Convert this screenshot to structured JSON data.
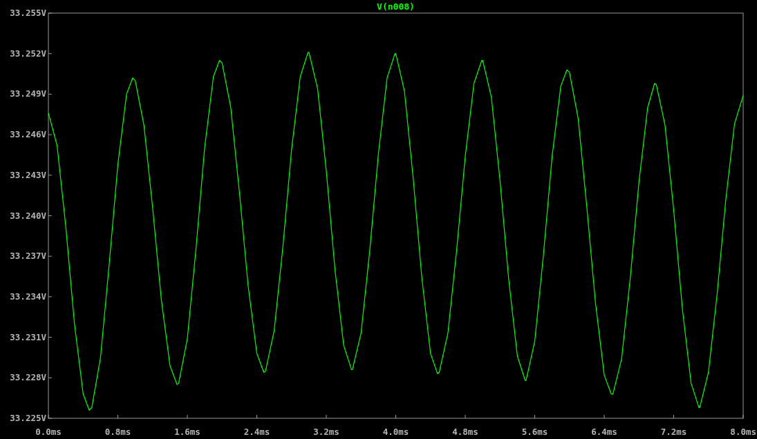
{
  "plot": {
    "chart_data": {
      "type": "line",
      "x": [
        0,
        0.1,
        0.2,
        0.3,
        0.4,
        0.47,
        0.5,
        0.6,
        0.7,
        0.8,
        0.9,
        0.97,
        1.0,
        1.1,
        1.2,
        1.3,
        1.4,
        1.48,
        1.5,
        1.6,
        1.7,
        1.8,
        1.9,
        1.97,
        2.0,
        2.1,
        2.2,
        2.3,
        2.4,
        2.48,
        2.5,
        2.6,
        2.7,
        2.8,
        2.9,
        2.99,
        3.0,
        3.1,
        3.2,
        3.3,
        3.4,
        3.49,
        3.5,
        3.6,
        3.7,
        3.8,
        3.9,
        3.99,
        4.0,
        4.1,
        4.2,
        4.3,
        4.4,
        4.48,
        4.5,
        4.6,
        4.7,
        4.8,
        4.9,
        4.99,
        5.0,
        5.1,
        5.2,
        5.3,
        5.4,
        5.49,
        5.5,
        5.6,
        5.7,
        5.8,
        5.9,
        5.97,
        6.0,
        6.1,
        6.2,
        6.3,
        6.4,
        6.48,
        6.5,
        6.6,
        6.7,
        6.8,
        6.9,
        6.98,
        7.0,
        7.1,
        7.2,
        7.3,
        7.4,
        7.49,
        7.5,
        7.6,
        7.7,
        7.8,
        7.9,
        8.0
      ],
      "series": [
        {
          "name": "V(n008)",
          "color": "#00ff00",
          "values": [
            33.2476,
            33.2452,
            33.2392,
            33.232,
            33.2268,
            33.2256,
            33.2258,
            33.2295,
            33.2364,
            33.2438,
            33.249,
            33.2502,
            33.25,
            33.2467,
            33.2406,
            33.2338,
            33.2289,
            33.2275,
            33.2276,
            33.2309,
            33.2376,
            33.2451,
            33.2503,
            33.2515,
            33.2513,
            33.248,
            33.2417,
            33.2348,
            33.2298,
            33.2284,
            33.2285,
            33.2315,
            33.2377,
            33.2449,
            33.2503,
            33.2521,
            33.2521,
            33.2494,
            33.2433,
            33.236,
            33.2304,
            33.2286,
            33.2286,
            33.2313,
            33.2374,
            33.2446,
            33.2502,
            33.252,
            33.252,
            33.2492,
            33.2428,
            33.2354,
            33.2298,
            33.2283,
            33.2284,
            33.2313,
            33.2374,
            33.2444,
            33.2498,
            33.2515,
            33.2515,
            33.2488,
            33.2426,
            33.2353,
            33.2296,
            33.2278,
            33.2278,
            33.2307,
            33.2371,
            33.2444,
            33.2496,
            33.2508,
            33.2506,
            33.2472,
            33.2406,
            33.2335,
            33.2282,
            33.2268,
            33.2268,
            33.2294,
            33.2354,
            33.2425,
            33.248,
            33.2498,
            33.2497,
            33.2467,
            33.2404,
            33.2331,
            33.2276,
            33.2258,
            33.2258,
            33.2284,
            33.2342,
            33.2412,
            33.2468,
            33.2489
          ]
        }
      ],
      "xlim": [
        0,
        8
      ],
      "ylim": [
        33.225,
        33.255
      ],
      "xticks": [
        {
          "value": 0,
          "label": "0.0ms"
        },
        {
          "value": 0.8,
          "label": "0.8ms"
        },
        {
          "value": 1.6,
          "label": "1.6ms"
        },
        {
          "value": 2.4,
          "label": "2.4ms"
        },
        {
          "value": 3.2,
          "label": "3.2ms"
        },
        {
          "value": 4.0,
          "label": "4.0ms"
        },
        {
          "value": 4.8,
          "label": "4.8ms"
        },
        {
          "value": 5.6,
          "label": "5.6ms"
        },
        {
          "value": 6.4,
          "label": "6.4ms"
        },
        {
          "value": 7.2,
          "label": "7.2ms"
        },
        {
          "value": 8.0,
          "label": "8.0ms"
        }
      ],
      "yticks": [
        {
          "value": 33.225,
          "label": "33.225V"
        },
        {
          "value": 33.228,
          "label": "33.228V"
        },
        {
          "value": 33.231,
          "label": "33.231V"
        },
        {
          "value": 33.234,
          "label": "33.234V"
        },
        {
          "value": 33.237,
          "label": "33.237V"
        },
        {
          "value": 33.24,
          "label": "33.240V"
        },
        {
          "value": 33.243,
          "label": "33.243V"
        },
        {
          "value": 33.246,
          "label": "33.246V"
        },
        {
          "value": 33.249,
          "label": "33.249V"
        },
        {
          "value": 33.252,
          "label": "33.252V"
        },
        {
          "value": 33.255,
          "label": "33.255V"
        }
      ]
    }
  }
}
